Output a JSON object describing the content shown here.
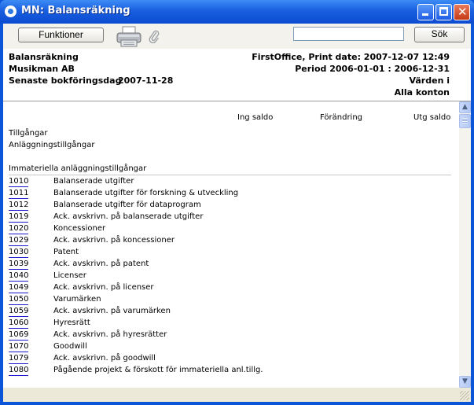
{
  "window": {
    "title": "MN: Balansräkning"
  },
  "toolbar": {
    "functions_label": "Funktioner",
    "search_label": "Sök",
    "search_value": ""
  },
  "header": {
    "report_title": "Balansräkning",
    "company": "Musikman AB",
    "last_posting_label": "Senaste bokföringsdag",
    "last_posting_date": "2007-11-28",
    "print_info": "FirstOffice, Print date: 2007-12-07 12:49",
    "period": "Period  2006-01-01 : 2006-12-31",
    "values_in": "Värden i",
    "all_accounts": "Alla konton"
  },
  "report": {
    "columns": [
      "Ing saldo",
      "Förändring",
      "Utg saldo"
    ],
    "section_assets": "Tillgångar",
    "section_fixed_assets": "Anläggningstillgångar",
    "section_intangible": "Immateriella anläggningstillgångar",
    "rows": [
      {
        "code": "1010",
        "name": "Balanserade utgifter"
      },
      {
        "code": "1011",
        "name": "Balanserade utgifter för forskning & utveckling"
      },
      {
        "code": "1012",
        "name": "Balanserade utgifter för dataprogram"
      },
      {
        "code": "1019",
        "name": "Ack. avskrivn. på balanserade utgifter"
      },
      {
        "code": "1020",
        "name": "Koncessioner"
      },
      {
        "code": "1029",
        "name": "Ack. avskrivn. på koncessioner"
      },
      {
        "code": "1030",
        "name": "Patent"
      },
      {
        "code": "1039",
        "name": "Ack. avskrivn. på patent"
      },
      {
        "code": "1040",
        "name": "Licenser"
      },
      {
        "code": "1049",
        "name": "Ack. avskrivn. på licenser"
      },
      {
        "code": "1050",
        "name": "Varumärken"
      },
      {
        "code": "1059",
        "name": "Ack. avskrivn. på varumärken"
      },
      {
        "code": "1060",
        "name": "Hyresrätt"
      },
      {
        "code": "1069",
        "name": "Ack. avskrivn. på hyresrätter"
      },
      {
        "code": "1070",
        "name": "Goodwill"
      },
      {
        "code": "1079",
        "name": "Ack. avskrivn. på goodwill"
      },
      {
        "code": "1080",
        "name": "Pågående projekt & förskott för immateriella anl.tillg."
      }
    ]
  }
}
